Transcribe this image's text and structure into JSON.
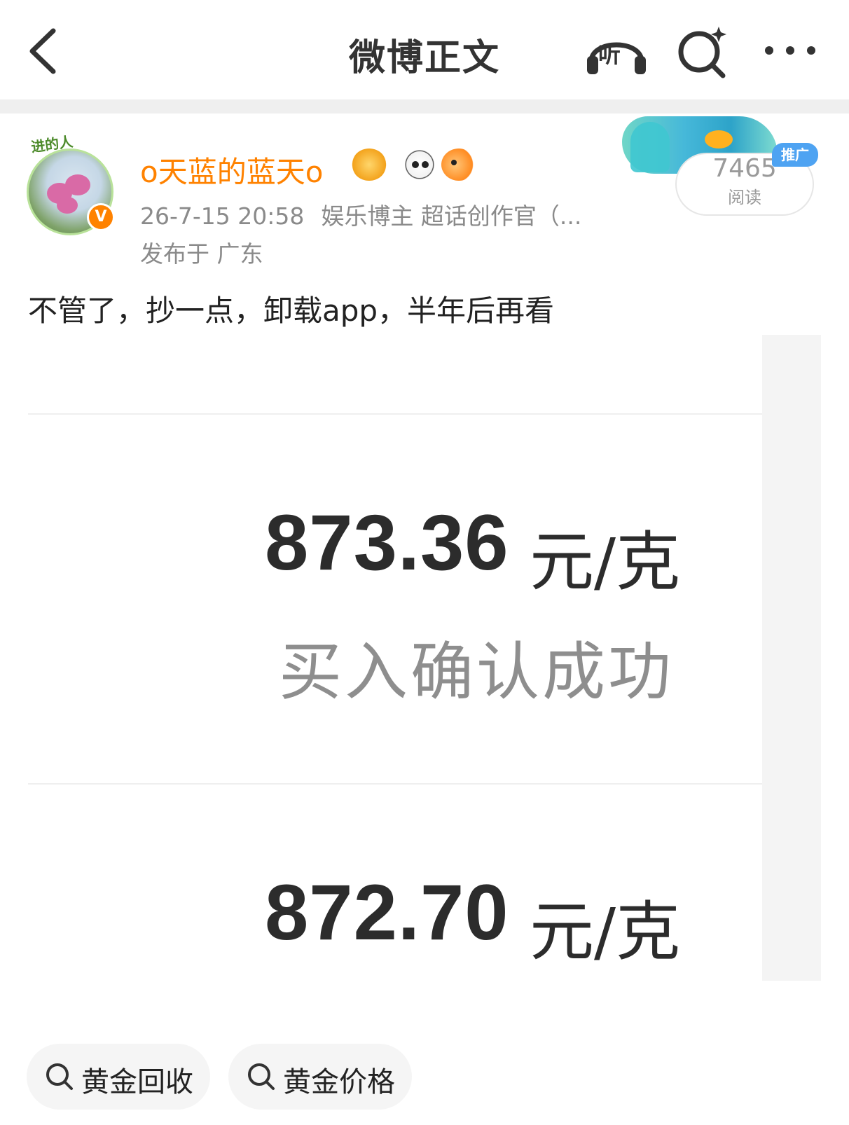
{
  "nav": {
    "title": "微博正文",
    "listen_label": "听"
  },
  "post": {
    "avatar_tag": "进的人",
    "verified_mark": "V",
    "username": "o天蓝的蓝天o",
    "badges": [
      "crown-badge",
      "panda-badge",
      "fish-badge"
    ],
    "meta": {
      "time": "26-7-15 20:58",
      "source": "娱乐博主 超话创作官（..."
    },
    "location": "发布于 广东",
    "text": "不管了，抄一点，卸载app，半年后再看"
  },
  "promo": {
    "read_count": "7465",
    "read_label": "阅读",
    "tag": "推广"
  },
  "image": {
    "price_1": "873.36",
    "unit_1": "元/克",
    "status": "买入确认成功",
    "price_2": "872.70",
    "unit_2": "元/克"
  },
  "topics": [
    {
      "label": "黄金回收",
      "icon": "search-icon"
    },
    {
      "label": "黄金价格",
      "icon": "search-icon"
    }
  ],
  "colors": {
    "accent_orange": "#ff8200",
    "promo_blue": "#4ea3f2",
    "meta_gray": "#8a8a8a"
  }
}
